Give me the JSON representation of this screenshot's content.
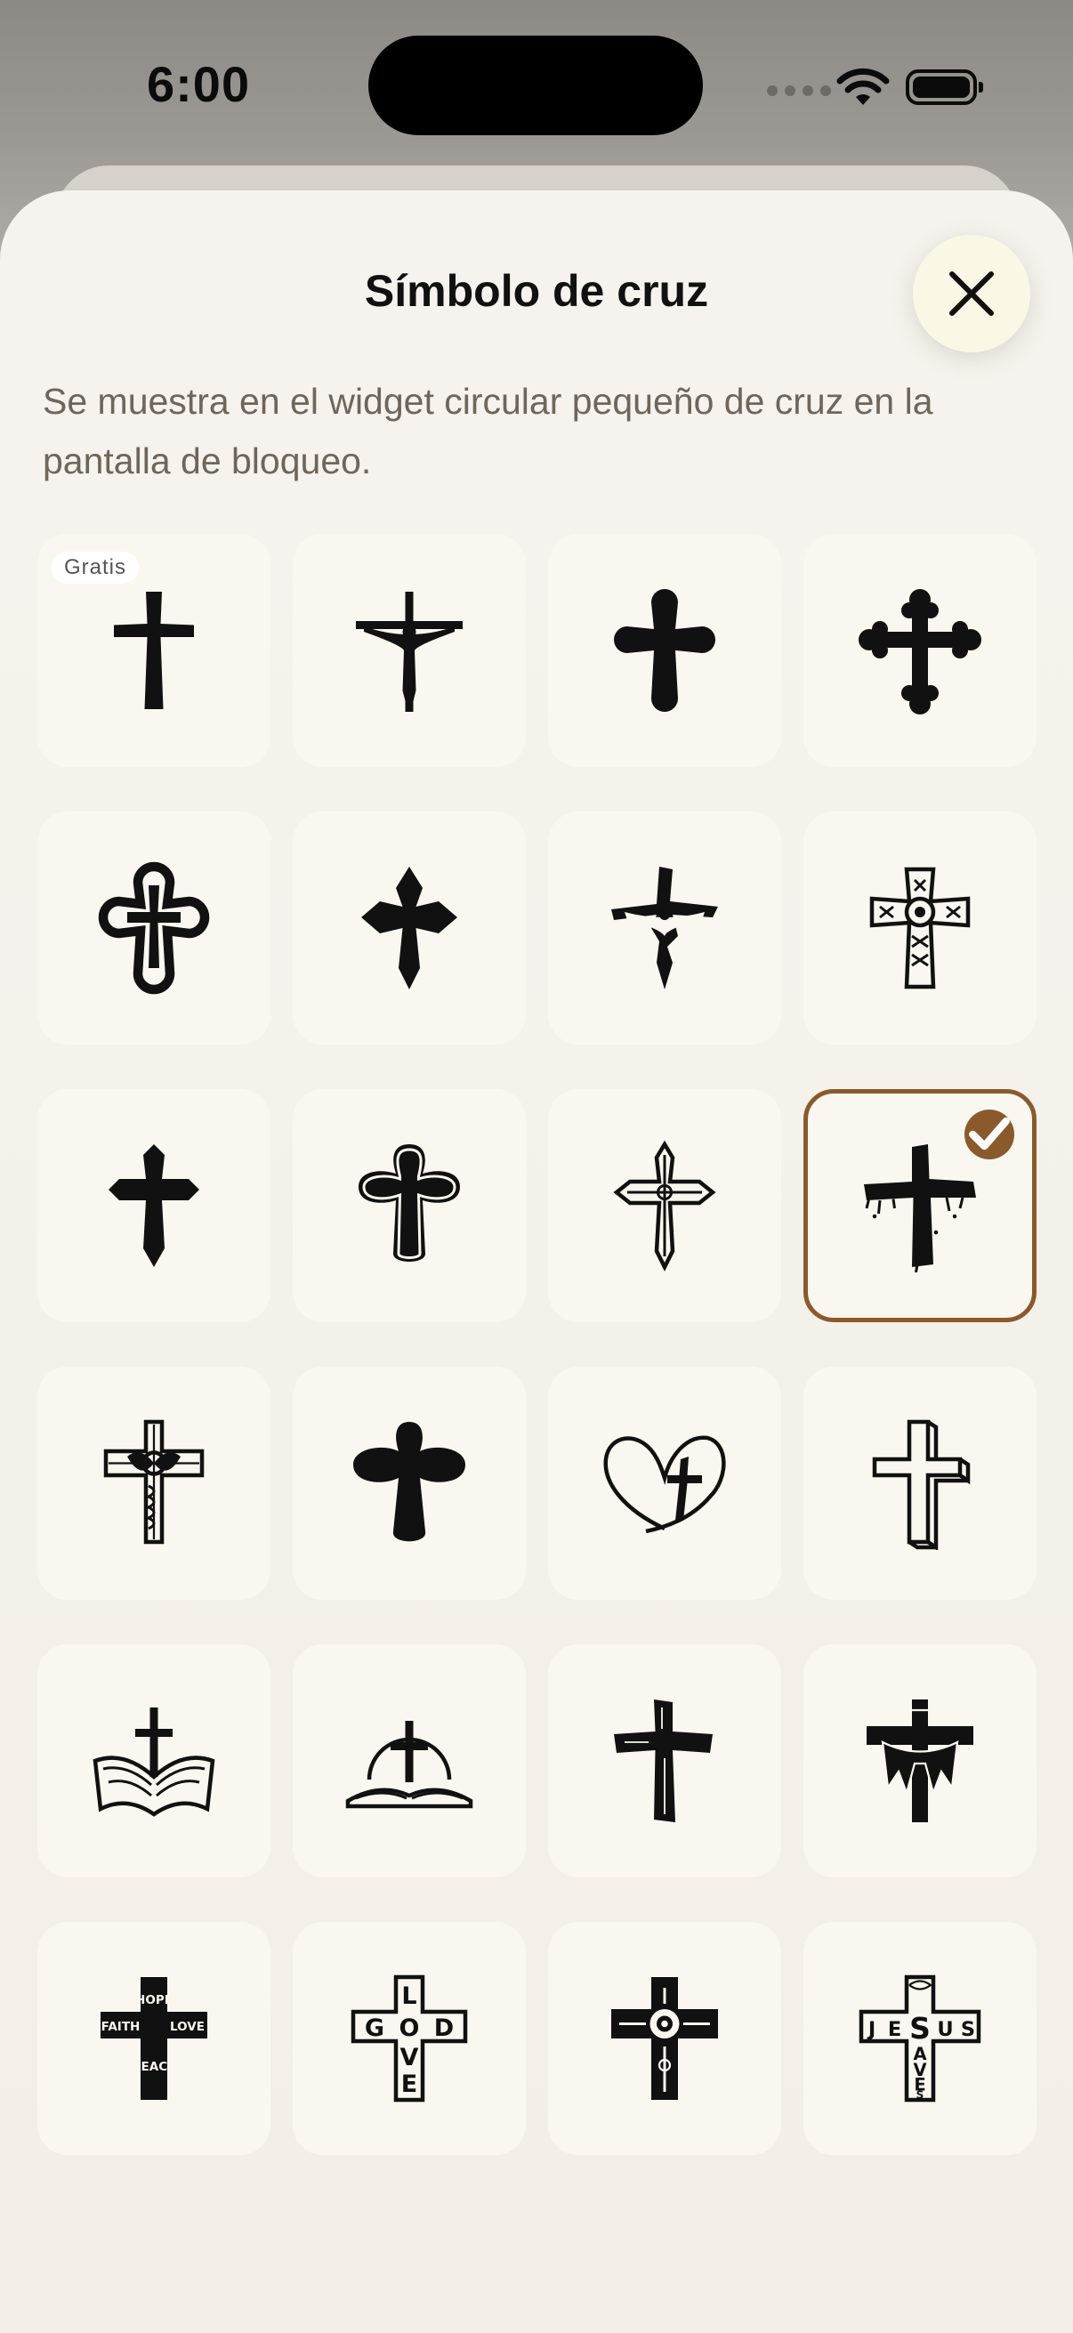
{
  "status_bar": {
    "time": "6:00"
  },
  "sheet": {
    "title": "Símbolo de cruz",
    "subtitle": "Se muestra en el widget circular pequeño de cruz en la pantalla de bloqueo."
  },
  "grid": {
    "free_badge": "Gratis",
    "selected_index": 11,
    "items": [
      {
        "name": "latin-cross-icon"
      },
      {
        "name": "crucifix-icon"
      },
      {
        "name": "budded-cross-icon"
      },
      {
        "name": "trefoil-cross-icon"
      },
      {
        "name": "outlined-budded-cross-icon"
      },
      {
        "name": "fleury-cross-icon"
      },
      {
        "name": "broken-crucifix-icon"
      },
      {
        "name": "ornate-celtic-cross-icon"
      },
      {
        "name": "gothic-cross-icon"
      },
      {
        "name": "outlined-rounded-cross-icon"
      },
      {
        "name": "ornate-outline-cross-icon"
      },
      {
        "name": "grunge-cross-icon"
      },
      {
        "name": "filigree-cross-icon"
      },
      {
        "name": "rounded-cross-icon"
      },
      {
        "name": "heart-cross-icon"
      },
      {
        "name": "3d-cross-icon"
      },
      {
        "name": "bible-cross-icon"
      },
      {
        "name": "bible-arch-cross-icon"
      },
      {
        "name": "wooden-cross-icon"
      },
      {
        "name": "draped-cross-icon"
      },
      {
        "name": "hope-faith-love-cross-icon",
        "text": [
          "HOPE",
          "FAITH",
          "LOVE",
          "PEACE"
        ]
      },
      {
        "name": "god-love-cross-icon",
        "text": [
          "G",
          "O",
          "D",
          "L",
          "V",
          "E"
        ]
      },
      {
        "name": "floral-cross-icon"
      },
      {
        "name": "jesus-saves-cross-icon",
        "text": [
          "J",
          "E",
          "S",
          "U",
          "S",
          "A",
          "V",
          "E",
          "S"
        ]
      }
    ]
  }
}
